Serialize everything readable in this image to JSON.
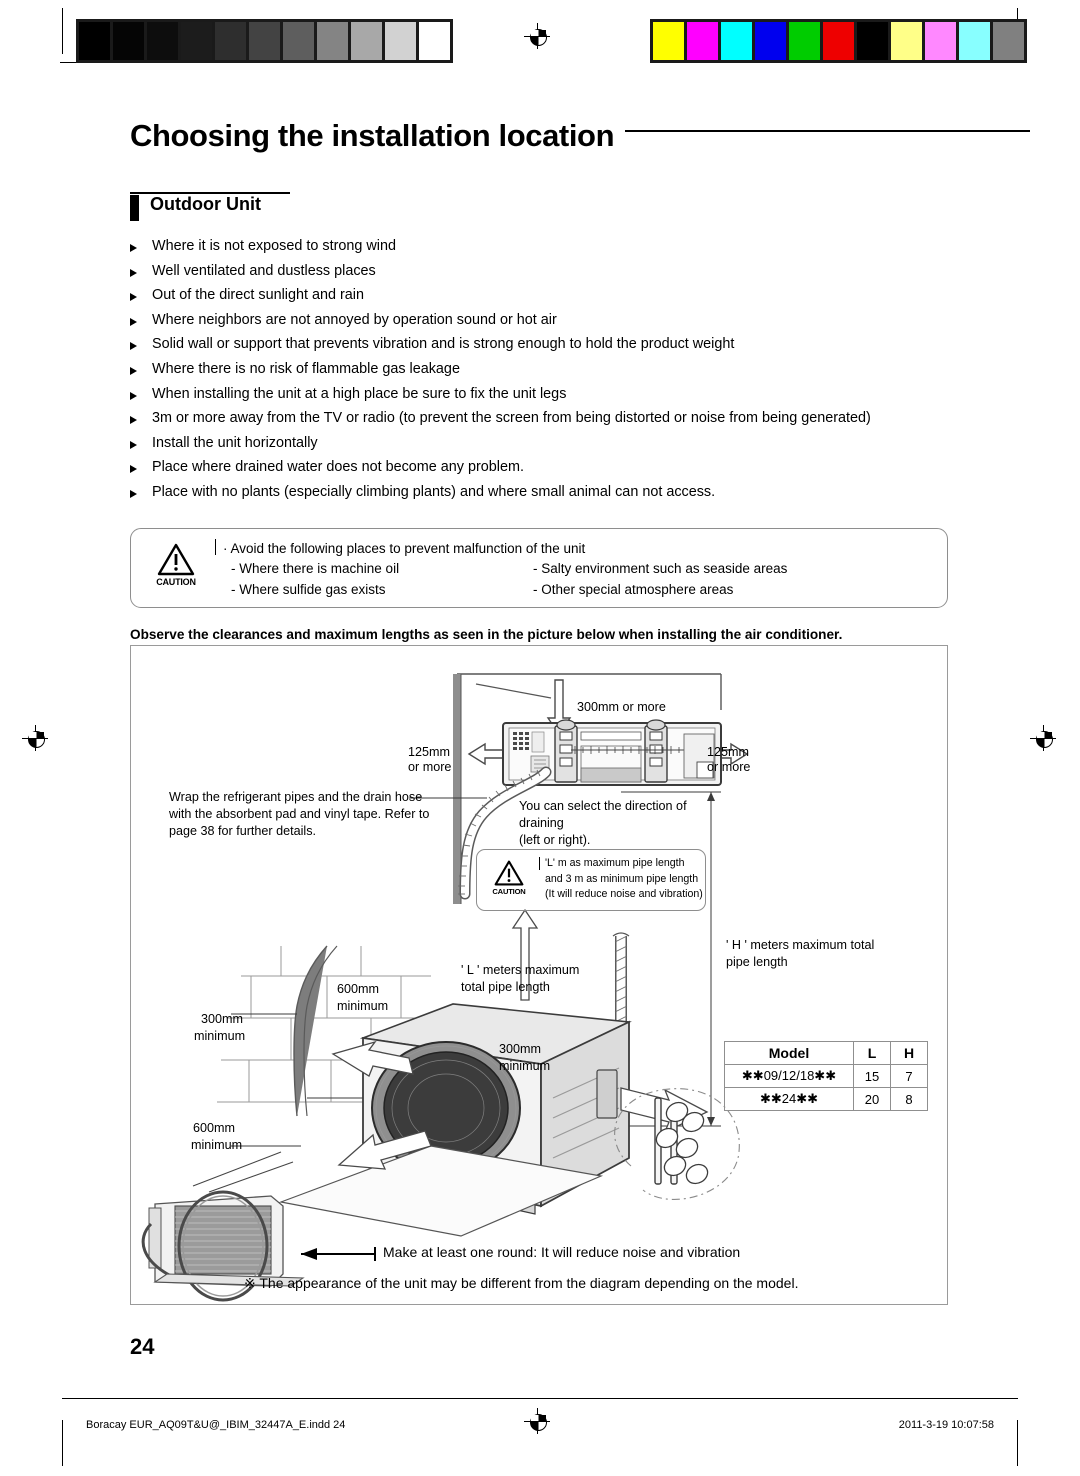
{
  "header": {
    "chapter_title": "Choosing the installation location",
    "section_title": "Outdoor Unit"
  },
  "bullets": [
    "Where it is not exposed to strong wind",
    "Well ventilated and dustless places",
    "Out of the direct sunlight and rain",
    "Where neighbors are not annoyed by operation sound or hot air",
    "Solid wall or support that prevents vibration and is strong enough to hold the product weight",
    "Where there is no risk of flammable gas leakage",
    "When installing the unit at a high place be sure to fix the unit legs",
    "3m or more away from the TV or radio (to prevent the screen from being distorted or noise from being generated)",
    "Install the unit horizontally",
    "Place where drained water does not become any problem.",
    "Place with no plants (especially climbing plants) and where small animal can not access."
  ],
  "caution": {
    "word": "CAUTION",
    "intro": "· Avoid the following places to prevent malfunction of the unit",
    "left": [
      "- Where there is machine oil",
      "- Where sulfide gas exists"
    ],
    "right": [
      "- Salty environment such as seaside areas",
      "- Other special atmosphere areas"
    ]
  },
  "observe_note": "Observe the clearances and maximum lengths as seen in the picture below when installing the air conditioner.",
  "diagram": {
    "clearance_top": "300mm or more",
    "clearance_left": "125mm\nor more",
    "clearance_left_l1": "125mm",
    "clearance_left_l2": "or more",
    "clearance_right_l1": "125mm",
    "clearance_right_l2": "or more",
    "wrap_note": "Wrap the refrigerant pipes and the drain hose with the absorbent pad and vinyl tape. Refer to page 38 for further details.",
    "wrap_note_lines": [
      "Wrap the refrigerant pipes and the drain hose",
      "with the absorbent pad and vinyl tape. Refer to",
      "page 38 for further details."
    ],
    "drain_note_lines": [
      "You can select the direction of",
      "draining",
      "(left or right)."
    ],
    "pipe_caution_lines": [
      "'L' m as maximum pipe length",
      "and 3 m as minimum pipe length",
      "(It will reduce noise and vibration)"
    ],
    "pipe_caution_word": "CAUTION",
    "l_label_lines": [
      "' L ' meters maximum",
      "total pipe length"
    ],
    "h_label_lines": [
      "' H ' meters maximum total",
      "pipe length"
    ],
    "dim_600_top_l1": "600mm",
    "dim_600_top_l2": "minimum",
    "dim_300_left_l1": "300mm",
    "dim_300_left_l2": "minimum",
    "dim_600_bottom_l1": "600mm",
    "dim_600_bottom_l2": "minimum",
    "dim_300_right_l1": "300mm",
    "dim_300_right_l2": "minimum",
    "round_note": "Make at least one round: It will reduce noise and vibration",
    "appearance_note": "※ The appearance of the unit may be different from the diagram depending on the model."
  },
  "model_table": {
    "headers": [
      "Model",
      "L",
      "H"
    ],
    "rows": [
      [
        "✱✱09/12/18✱✱",
        "15",
        "7"
      ],
      [
        "✱✱24✱✱",
        "20",
        "8"
      ]
    ]
  },
  "footer": {
    "page_number": "24",
    "file_name": "Boracay EUR_AQ09T&U@_IBIM_32447A_E.indd   24",
    "timestamp": "2011-3-19   10:07:58"
  },
  "calibration": {
    "grayscale": [
      "#000000",
      "#050505",
      "#0d0d0d",
      "#1c1c1c",
      "#2e2e2e",
      "#434343",
      "#5e5e5e",
      "#848484",
      "#a8a8a8",
      "#d2d2d2",
      "#ffffff"
    ],
    "colors": [
      "#ffff00",
      "#ff00ff",
      "#00ffff",
      "#0000ee",
      "#00cc00",
      "#ee0000",
      "#000000",
      "#ffff88",
      "#ff88ff",
      "#88ffff",
      "#808080"
    ]
  }
}
